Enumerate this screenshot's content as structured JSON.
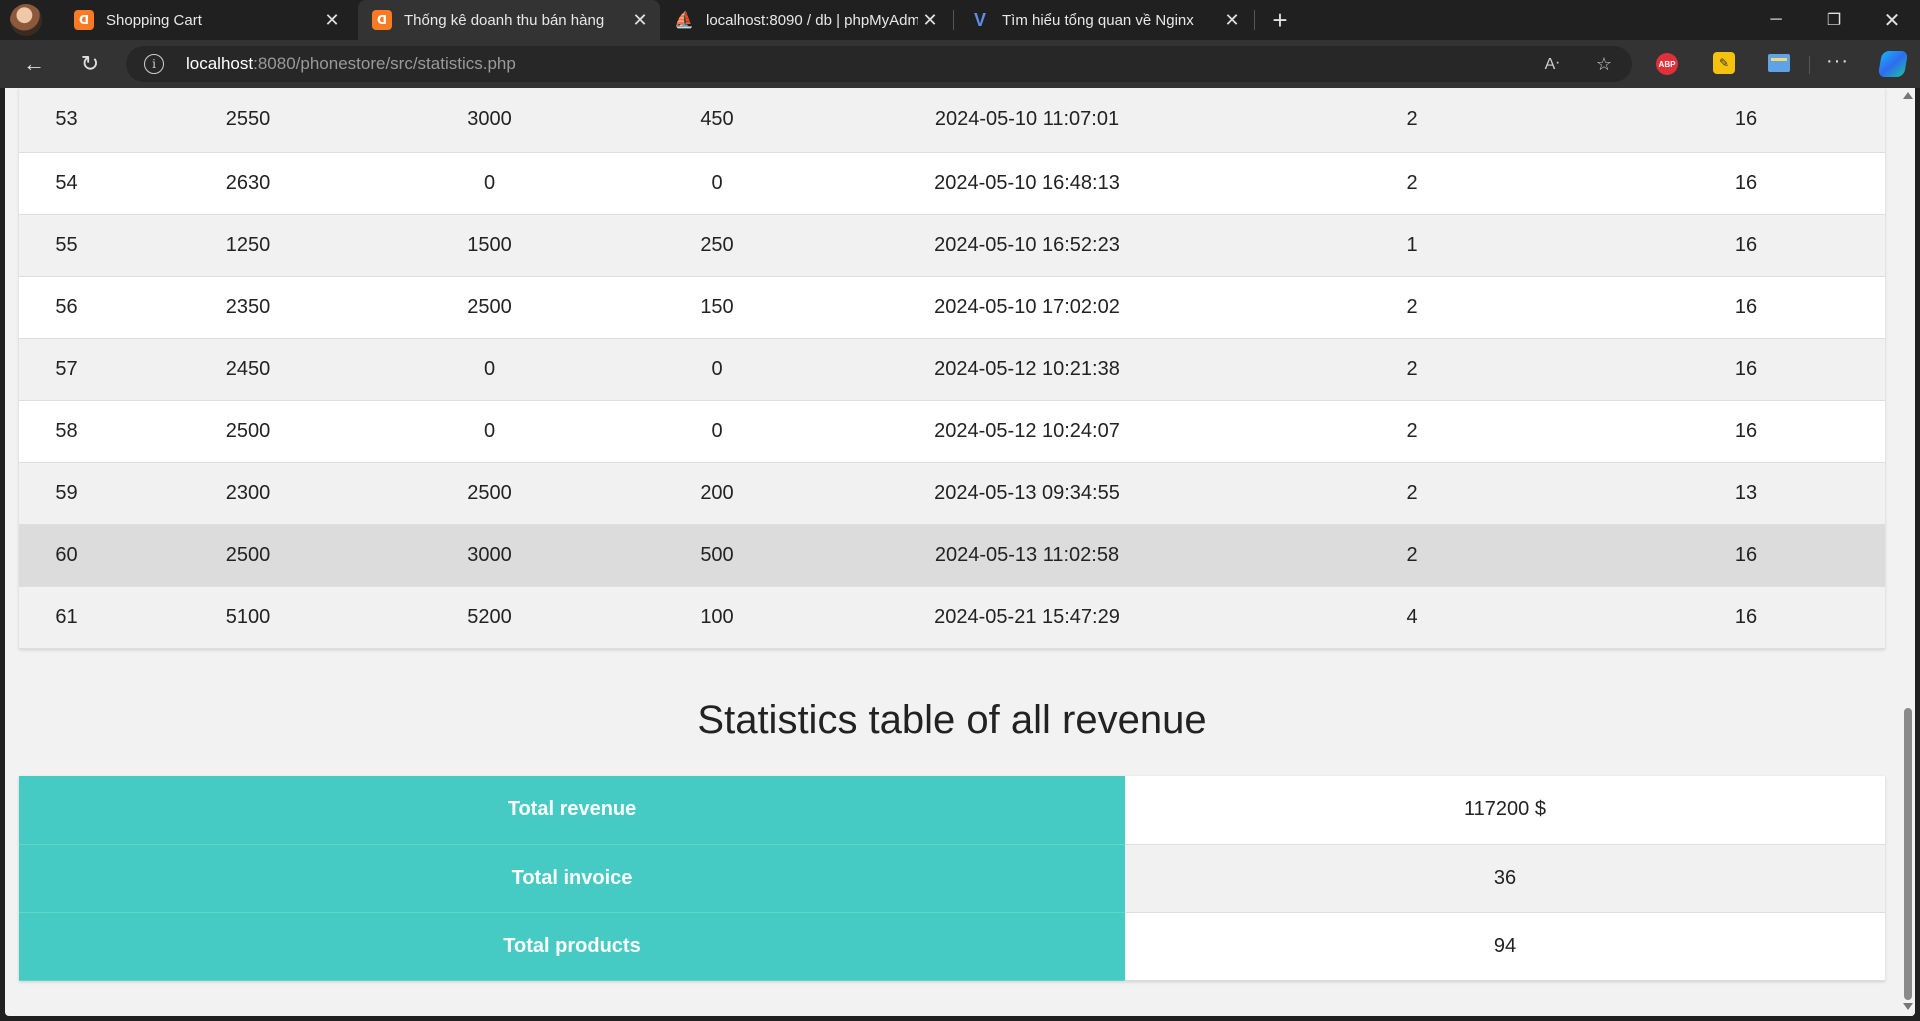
{
  "browser": {
    "tabs": [
      {
        "title": "Shopping Cart",
        "icon": "xampp-icon",
        "active": false
      },
      {
        "title": "Thống kê doanh thu bán hàng",
        "icon": "xampp-icon",
        "active": true
      },
      {
        "title": "localhost:8090 / db | phpMyAdmin",
        "icon": "phpmyadmin-icon",
        "active": false
      },
      {
        "title": "Tìm hiểu tổng quan về Nginx",
        "icon": "v-icon",
        "active": false
      }
    ],
    "url_host": "localhost",
    "url_rest": ":8080/phonestore/src/statistics.php",
    "extensions": {
      "abp_label": "ABP"
    }
  },
  "orders": [
    [
      "53",
      "2550",
      "3000",
      "450",
      "2024-05-10 11:07:01",
      "2",
      "16"
    ],
    [
      "54",
      "2630",
      "0",
      "0",
      "2024-05-10 16:48:13",
      "2",
      "16"
    ],
    [
      "55",
      "1250",
      "1500",
      "250",
      "2024-05-10 16:52:23",
      "1",
      "16"
    ],
    [
      "56",
      "2350",
      "2500",
      "150",
      "2024-05-10 17:02:02",
      "2",
      "16"
    ],
    [
      "57",
      "2450",
      "0",
      "0",
      "2024-05-12 10:21:38",
      "2",
      "16"
    ],
    [
      "58",
      "2500",
      "0",
      "0",
      "2024-05-12 10:24:07",
      "2",
      "16"
    ],
    [
      "59",
      "2300",
      "2500",
      "200",
      "2024-05-13 09:34:55",
      "2",
      "13"
    ],
    [
      "60",
      "2500",
      "3000",
      "500",
      "2024-05-13 11:02:58",
      "2",
      "16"
    ],
    [
      "61",
      "5100",
      "5200",
      "100",
      "2024-05-21 15:47:29",
      "4",
      "16"
    ]
  ],
  "summary": {
    "title": "Statistics table of all revenue",
    "rows": [
      {
        "label": "Total revenue",
        "value": "117200 $"
      },
      {
        "label": "Total invoice",
        "value": "36"
      },
      {
        "label": "Total products",
        "value": "94"
      }
    ]
  },
  "colors": {
    "accent": "#45cbc3",
    "hover_row": "#dcdcdc"
  }
}
